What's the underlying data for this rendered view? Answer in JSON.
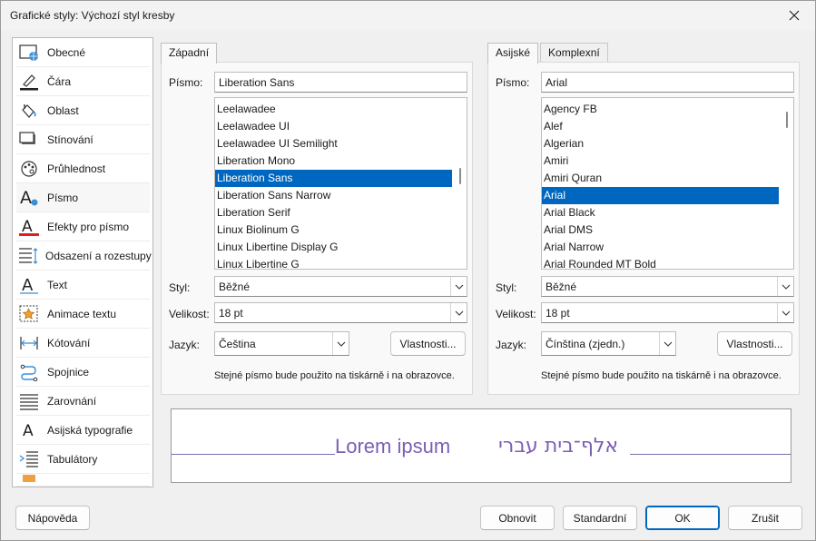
{
  "window": {
    "title": "Grafické styly: Výchozí styl kresby"
  },
  "sidebar": {
    "items": [
      {
        "label": "Obecné",
        "icon": "general-icon"
      },
      {
        "label": "Čára",
        "icon": "line-icon"
      },
      {
        "label": "Oblast",
        "icon": "area-icon"
      },
      {
        "label": "Stínování",
        "icon": "shadow-icon"
      },
      {
        "label": "Průhlednost",
        "icon": "transparency-icon"
      },
      {
        "label": "Písmo",
        "icon": "font-icon",
        "selected": true
      },
      {
        "label": "Efekty pro písmo",
        "icon": "font-effects-icon"
      },
      {
        "label": "Odsazení a rozestupy",
        "icon": "indents-spacing-icon"
      },
      {
        "label": "Text",
        "icon": "text-icon"
      },
      {
        "label": "Animace textu",
        "icon": "text-animation-icon"
      },
      {
        "label": "Kótování",
        "icon": "dimensioning-icon"
      },
      {
        "label": "Spojnice",
        "icon": "connector-icon"
      },
      {
        "label": "Zarovnání",
        "icon": "alignment-icon"
      },
      {
        "label": "Asijská typografie",
        "icon": "asian-typography-icon"
      },
      {
        "label": "Tabulátory",
        "icon": "tabs-icon"
      }
    ]
  },
  "western": {
    "tab": "Západní",
    "font_label": "Písmo:",
    "font_value": "Liberation Sans",
    "fonts": [
      "Leelawadee",
      "Leelawadee UI",
      "Leelawadee UI Semilight",
      "Liberation Mono",
      "Liberation Sans",
      "Liberation Sans Narrow",
      "Liberation Serif",
      "Linux Biolinum G",
      "Linux Libertine Display G",
      "Linux Libertine G"
    ],
    "selected_index": 4,
    "style_label": "Styl:",
    "style_value": "Běžné",
    "size_label": "Velikost:",
    "size_value": "18 pt",
    "lang_label": "Jazyk:",
    "lang_value": "Čeština",
    "features_button": "Vlastnosti...",
    "note": "Stejné písmo bude použito na tiskárně i na obrazovce."
  },
  "asian": {
    "tabs": [
      "Asijské",
      "Komplexní"
    ],
    "font_label": "Písmo:",
    "font_value": "Arial",
    "fonts": [
      "Agency FB",
      "Alef",
      "Algerian",
      "Amiri",
      "Amiri Quran",
      "Arial",
      "Arial Black",
      "Arial DMS",
      "Arial Narrow",
      "Arial Rounded MT Bold"
    ],
    "selected_index": 5,
    "style_label": "Styl:",
    "style_value": "Běžné",
    "size_label": "Velikost:",
    "size_value": "18 pt",
    "lang_label": "Jazyk:",
    "lang_value": "Čínština (zjedn.)",
    "features_button": "Vlastnosti...",
    "note": "Stejné písmo bude použito na tiskárně i na obrazovce."
  },
  "preview": {
    "western_text": "Lorem ipsum",
    "asian_text": "אלף־בית עברי",
    "text_color": "#7b5fb6"
  },
  "footer": {
    "help": "Nápověda",
    "reset": "Obnovit",
    "standard": "Standardní",
    "ok": "OK",
    "cancel": "Zrušit"
  },
  "colors": {
    "accent": "#0067c0",
    "font_effects_red": "#e02020"
  }
}
